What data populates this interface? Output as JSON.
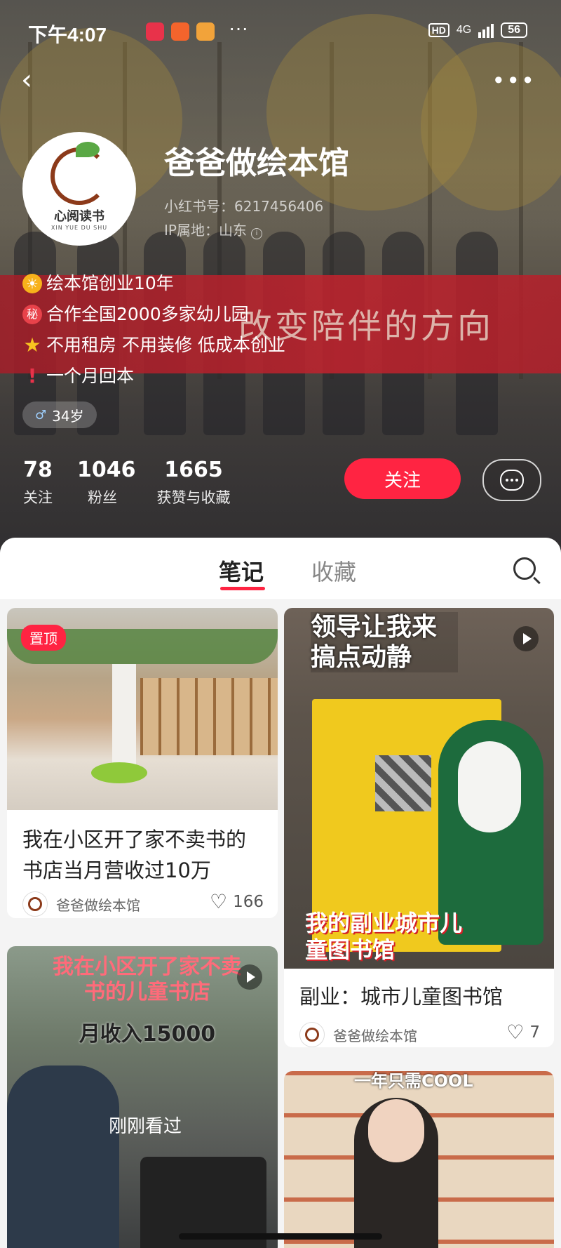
{
  "status_bar": {
    "time": "下午4:07",
    "dots": "···",
    "network": "4G",
    "hd": "HD",
    "battery": "56"
  },
  "profile": {
    "name": "爸爸做绘本馆",
    "id_line": "小红书号：6217456406",
    "ip_line": "IP属地：山东",
    "avatar_text": "心阅读书",
    "avatar_sub": "XIN YUE DU SHU",
    "banner_text": "改变陪伴的方向",
    "bio": [
      {
        "icon": "sun-emoji-icon",
        "text": "绘本馆创业10年"
      },
      {
        "icon": "secret-emoji-icon",
        "text": "合作全国2000多家幼儿园"
      },
      {
        "icon": "star-emoji-icon",
        "text": "不用租房 不用装修 低成本创业"
      },
      {
        "icon": "exclamation-emoji-icon",
        "text": "一个月回本"
      }
    ],
    "age": "34岁",
    "stats": [
      {
        "num": "78",
        "label": "关注"
      },
      {
        "num": "1046",
        "label": "粉丝"
      },
      {
        "num": "1665",
        "label": "获赞与收藏"
      }
    ],
    "follow_label": "关注"
  },
  "tabs": {
    "notes": "笔记",
    "collect": "收藏"
  },
  "feed": [
    {
      "badge": "置顶",
      "title": "我在小区开了家不卖书的书店当月营收过10万",
      "author": "爸爸做绘本馆",
      "likes": "166"
    },
    {
      "overlay_top": "领导让我来搞点动静",
      "overlay_bottom": "我的副业城市儿童图书馆",
      "title": "副业：城市儿童图书馆",
      "author": "爸爸做绘本馆",
      "likes": "7"
    },
    {
      "overlay_top": "我在小区开了家不卖书的儿童书店",
      "overlay_sub": "月收入15000",
      "watched": "刚刚看过"
    },
    {
      "overlay_top": "一年只需COOL"
    }
  ],
  "colors": {
    "accent": "#ff2442"
  }
}
